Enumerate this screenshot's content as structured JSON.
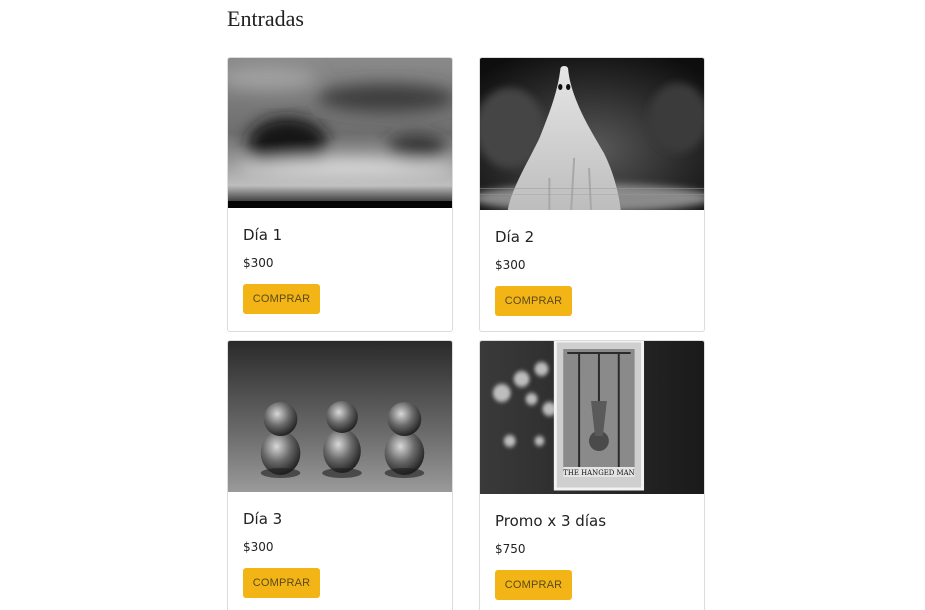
{
  "page": {
    "title": "Entradas"
  },
  "cards": [
    {
      "title": "Día 1",
      "price": "$300",
      "button": "COMPRAR",
      "image_icon": "blurred-clouds-image"
    },
    {
      "title": "Día 2",
      "price": "$300",
      "button": "COMPRAR",
      "image_icon": "ghost-sheet-image"
    },
    {
      "title": "Día 3",
      "price": "$300",
      "button": "COMPRAR",
      "image_icon": "three-monkeys-image"
    },
    {
      "title": "Promo x 3 días",
      "price": "$750",
      "button": "COMPRAR",
      "image_icon": "hanged-man-tarot-image"
    }
  ],
  "colors": {
    "button_bg": "#f2b515",
    "card_border": "#dcdcdc",
    "text": "#222222"
  }
}
